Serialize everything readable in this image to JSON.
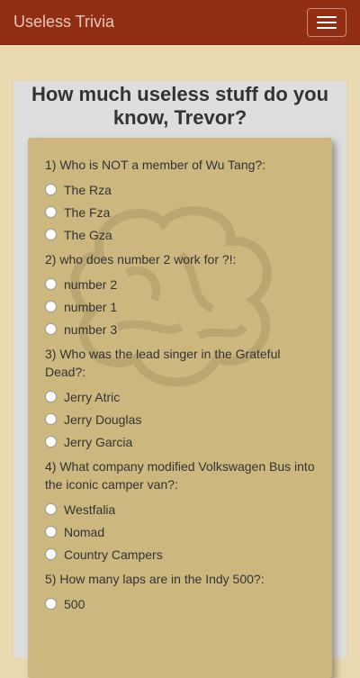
{
  "navbar": {
    "brand": "Useless Trivia"
  },
  "quiz": {
    "title": "How much useless stuff do you know, Trevor?",
    "questions": [
      {
        "text": "1) Who is NOT a member of Wu Tang?:",
        "options": [
          "The Rza",
          "The Fza",
          "The Gza"
        ]
      },
      {
        "text": "2) who does number 2 work for ?!:",
        "options": [
          "number 2",
          "number 1",
          "number 3"
        ]
      },
      {
        "text": "3) Who was the lead singer in the Grateful Dead?:",
        "options": [
          "Jerry Atric",
          "Jerry Douglas",
          "Jerry Garcia"
        ]
      },
      {
        "text": "4) What company modified Volkswagen Bus into the iconic camper van?:",
        "options": [
          "Westfalia",
          "Nomad",
          "Country Campers"
        ]
      },
      {
        "text": "5) How many laps are in the Indy 500?:",
        "options": [
          "500"
        ]
      }
    ]
  },
  "colors": {
    "navbar": "#922e14",
    "background": "#e8d9b0",
    "card": "#ccb87f"
  }
}
